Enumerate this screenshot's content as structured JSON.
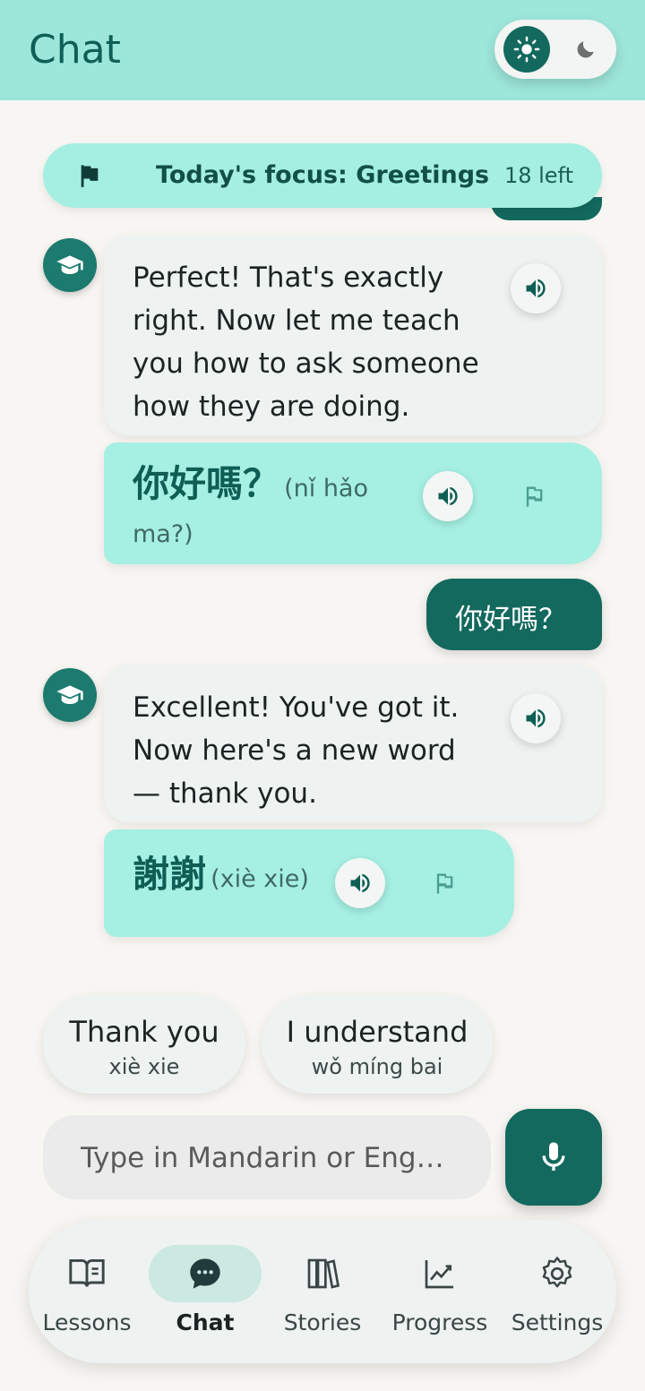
{
  "header": {
    "title": "Chat",
    "theme_toggle": {
      "active": "light",
      "icons": [
        "sun-icon",
        "moon-icon"
      ]
    }
  },
  "focus_banner": {
    "text": "Today's focus: Greetings",
    "remaining": "18 left"
  },
  "messages": [
    {
      "type": "bot",
      "text": "Perfect! That's exactly right. Now let me teach you how to ask someone how they are doing."
    },
    {
      "type": "vocab",
      "hanzi": "你好嗎？",
      "pinyin": "(nǐ hǎo ma?)"
    },
    {
      "type": "user",
      "text": "你好嗎？"
    },
    {
      "type": "bot",
      "text": "Excellent! You've got it. Now here's a new word — thank you."
    },
    {
      "type": "vocab",
      "hanzi": "謝謝",
      "pinyin": "(xiè xie)"
    }
  ],
  "quick_replies": [
    {
      "label": "Thank you",
      "pinyin": "xiè xie"
    },
    {
      "label": "I understand",
      "pinyin": "wǒ míng bai"
    }
  ],
  "composer": {
    "placeholder": "Type in Mandarin or Eng…"
  },
  "nav": {
    "items": [
      {
        "label": "Lessons",
        "icon": "book-open-icon"
      },
      {
        "label": "Chat",
        "icon": "chat-bubble-icon",
        "active": true
      },
      {
        "label": "Stories",
        "icon": "books-icon"
      },
      {
        "label": "Progress",
        "icon": "chart-line-icon"
      },
      {
        "label": "Settings",
        "icon": "gear-icon"
      }
    ]
  },
  "colors": {
    "header": "#9de6da",
    "accent": "#13695e",
    "vocab_bubble": "#a6f0e3",
    "bot_bubble": "#eef2f1"
  }
}
